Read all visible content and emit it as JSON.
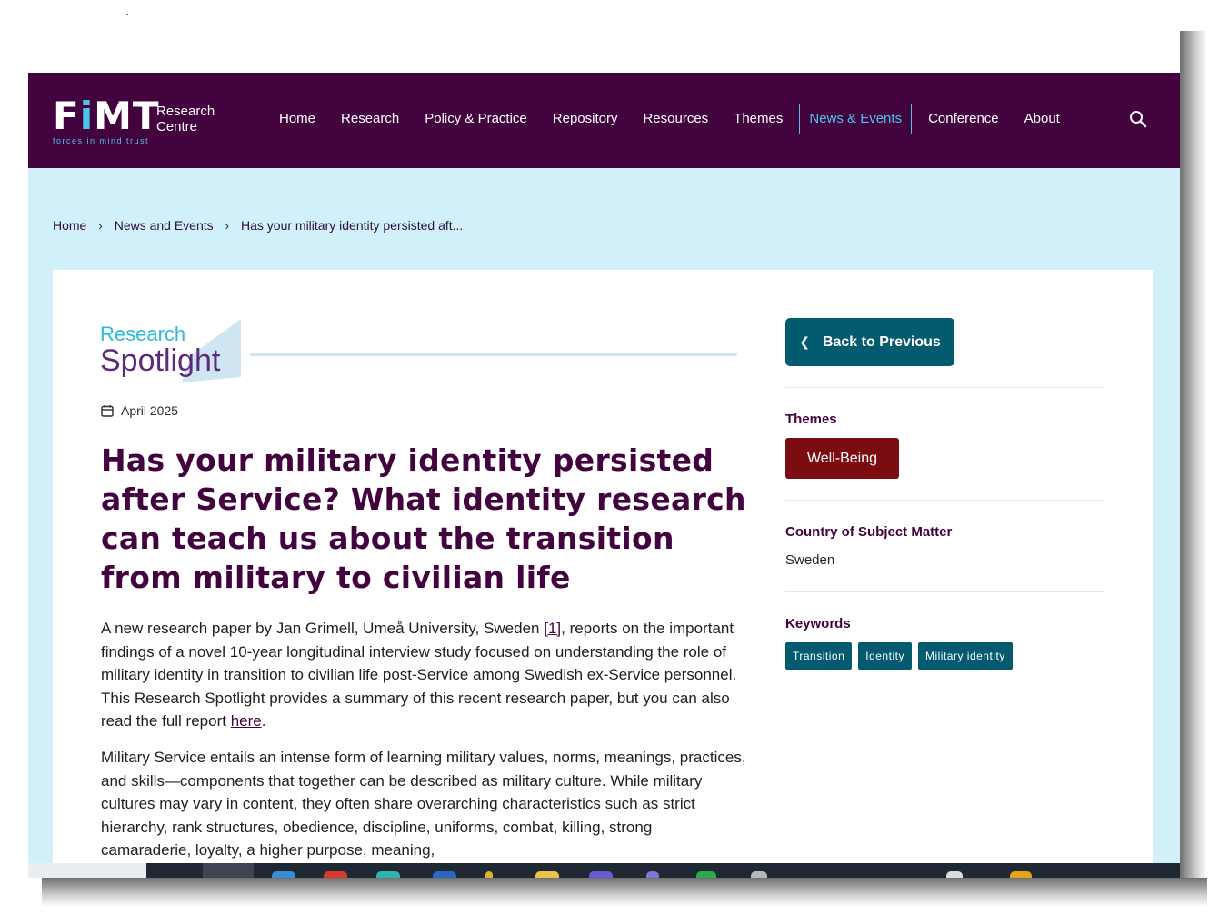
{
  "header": {
    "logo_word_start": "F",
    "logo_word_i": "i",
    "logo_word_end": "MT",
    "logo_tagline": "forces in mind trust",
    "logo_rc_line1": "Research",
    "logo_rc_line2": "Centre",
    "nav": [
      "Home",
      "Research",
      "Policy & Practice",
      "Repository",
      "Resources",
      "Themes",
      "News & Events",
      "Conference",
      "About"
    ],
    "active_nav": "News & Events",
    "search_icon": "search-icon"
  },
  "breadcrumb": [
    "Home",
    "News and Events",
    "Has your military identity persisted aft..."
  ],
  "article": {
    "badge_line1": "Research",
    "badge_line2": "Spotlight",
    "date": "April 2025",
    "title": "Has your military identity persisted after Service? What identity research can teach us about the transition from military to civilian life",
    "p1_a": "A new research paper by Jan Grimell, Umeå University, Sweden ",
    "p1_ref": "[1]",
    "p1_b": ", reports on the important findings of a novel 10-year longitudinal interview study focused on understanding the role of military identity in transition to civilian life post-Service among Swedish ex-Service personnel. This Research Spotlight provides a summary of this recent research paper, but you can also read the full report ",
    "p1_link": "here",
    "p1_end": ".",
    "p2": "Military Service entails an intense form of learning military values, norms, meanings, practices, and skills—components that together can be described as military culture. While military cultures may vary in content, they often share overarching characteristics such as strict hierarchy, rank structures, obedience, discipline, uniforms, combat, killing, strong camaraderie, loyalty, a higher purpose, meaning,"
  },
  "sidebar": {
    "back_label": "Back to Previous",
    "themes_label": "Themes",
    "theme_tag": "Well-Being",
    "country_label": "Country of Subject Matter",
    "country_value": "Sweden",
    "keywords_label": "Keywords",
    "keywords": [
      "Transition",
      "Identity",
      "Military identity"
    ]
  },
  "colors": {
    "header_bg": "#43033f",
    "accent_cyan": "#4fc3ea",
    "page_bg": "#d1f0fa",
    "teal_button": "#045a6e",
    "theme_red": "#7b0d12"
  }
}
